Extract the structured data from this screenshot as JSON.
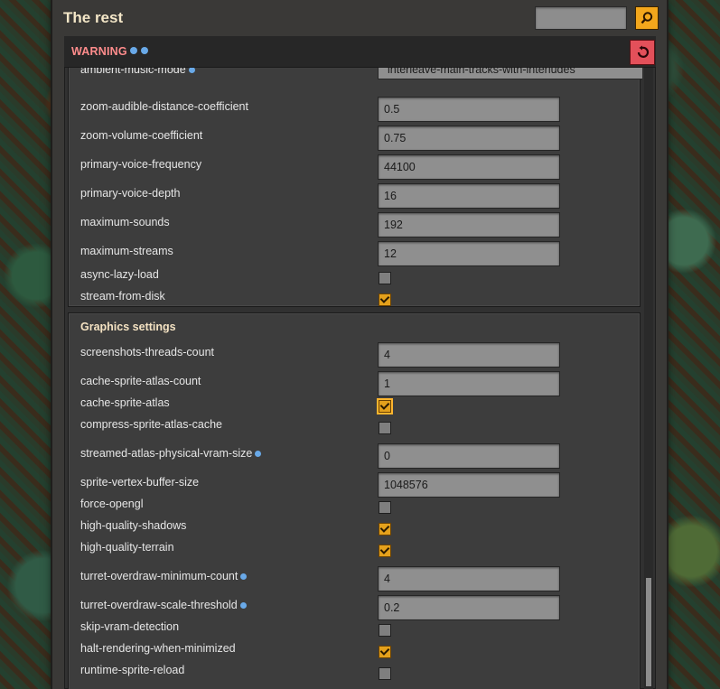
{
  "window": {
    "title": "The rest",
    "search_value": ""
  },
  "warning": {
    "label": "WARNING",
    "icons": [
      "info-icon",
      "info-icon"
    ]
  },
  "colors": {
    "accent": "#f3a71c",
    "warning_text": "#ff8c8c",
    "reset_button": "#e3505a"
  },
  "sound_section": {
    "dropdown_label": "ambient-music-mode",
    "dropdown_value": "interleave-main-tracks-with-interludes",
    "rows": [
      {
        "label": "zoom-audible-distance-coefficient",
        "value": "0.5"
      },
      {
        "label": "zoom-volume-coefficient",
        "value": "0.75"
      },
      {
        "label": "primary-voice-frequency",
        "value": "44100"
      },
      {
        "label": "primary-voice-depth",
        "value": "16"
      },
      {
        "label": "maximum-sounds",
        "value": "192"
      },
      {
        "label": "maximum-streams",
        "value": "12"
      }
    ],
    "checks": [
      {
        "label": "async-lazy-load",
        "checked": false
      },
      {
        "label": "stream-from-disk",
        "checked": true
      }
    ]
  },
  "graphics_section": {
    "title": "Graphics settings",
    "items": [
      {
        "label": "screenshots-threads-count",
        "value": "4"
      },
      {
        "label": "cache-sprite-atlas-count",
        "value": "1"
      },
      {
        "label": "cache-sprite-atlas",
        "checked": true
      },
      {
        "label": "compress-sprite-atlas-cache",
        "checked": false
      },
      {
        "label": "streamed-atlas-physical-vram-size",
        "value": "0"
      },
      {
        "label": "sprite-vertex-buffer-size",
        "value": "1048576"
      },
      {
        "label": "force-opengl",
        "checked": false
      },
      {
        "label": "high-quality-shadows",
        "checked": true
      },
      {
        "label": "high-quality-terrain",
        "checked": true
      },
      {
        "label": "turret-overdraw-minimum-count",
        "value": "4"
      },
      {
        "label": "turret-overdraw-scale-threshold",
        "value": "0.2"
      },
      {
        "label": "skip-vram-detection",
        "checked": false
      },
      {
        "label": "halt-rendering-when-minimized",
        "checked": true
      },
      {
        "label": "runtime-sprite-reload",
        "checked": false
      }
    ]
  },
  "scroll": {
    "position_fraction": 0.85
  }
}
